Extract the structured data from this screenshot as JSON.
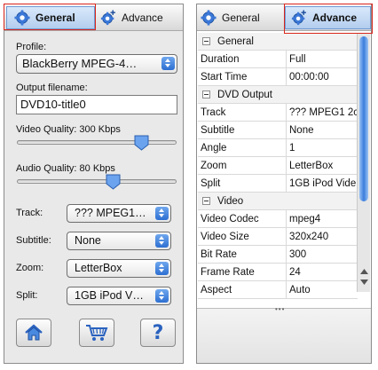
{
  "left": {
    "tabs": {
      "general": "General",
      "advance": "Advance"
    },
    "profile_label": "Profile:",
    "profile_value": "BlackBerry MPEG-4…",
    "output_label": "Output filename:",
    "output_value": "DVD10-title0",
    "video_quality_label": "Video Quality:  300 Kbps",
    "video_quality_level": 0.78,
    "audio_quality_label": "Audio Quality:  80 Kbps",
    "audio_quality_level": 0.6,
    "track_label": "Track:",
    "track_value": "??? MPEG1…",
    "subtitle_label": "Subtitle:",
    "subtitle_value": "None",
    "zoom_label": "Zoom:",
    "zoom_value": "LetterBox",
    "split_label": "Split:",
    "split_value": "1GB iPod V…",
    "bottom_icons": [
      "home-icon",
      "cart-icon",
      "help-icon"
    ],
    "help_glyph": "?"
  },
  "right": {
    "tabs": {
      "general": "General",
      "advance": "Advance"
    },
    "sections": [
      {
        "title": "General",
        "rows": [
          {
            "key": "Duration",
            "value": "Full"
          },
          {
            "key": "Start Time",
            "value": "00:00:00"
          }
        ]
      },
      {
        "title": "DVD Output",
        "rows": [
          {
            "key": "Track",
            "value": "??? MPEG1 2c"
          },
          {
            "key": "Subtitle",
            "value": "None"
          },
          {
            "key": "Angle",
            "value": "1"
          },
          {
            "key": "Zoom",
            "value": "LetterBox"
          },
          {
            "key": "Split",
            "value": "1GB iPod Vide"
          }
        ]
      },
      {
        "title": "Video",
        "rows": [
          {
            "key": "Video Codec",
            "value": "mpeg4"
          },
          {
            "key": "Video Size",
            "value": "320x240"
          },
          {
            "key": "Bit Rate",
            "value": "300"
          },
          {
            "key": "Frame Rate",
            "value": "24"
          },
          {
            "key": "Aspect",
            "value": "Auto"
          }
        ]
      }
    ],
    "resize_grip": "•••"
  },
  "colors": {
    "accent": "#2d6fd1",
    "highlight_box": "#d9261c",
    "tab_active": "#b3cdee"
  }
}
